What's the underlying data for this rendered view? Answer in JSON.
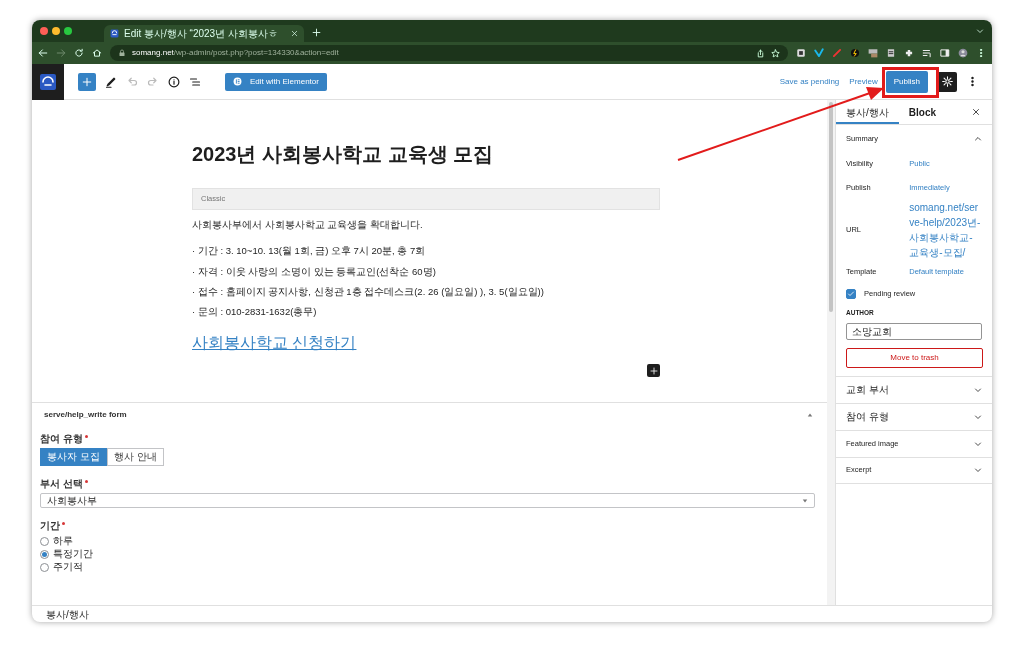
{
  "browser": {
    "tab_title": "Edit 봉사/행사 “2023년 사회봉사ㅎ",
    "url_domain": "somang.net",
    "url_path": "/wp-admin/post.php?post=134330&action=edit"
  },
  "toolbar": {
    "elementor_button": "Edit with Elementor",
    "save_pending": "Save as pending",
    "preview": "Preview",
    "publish": "Publish"
  },
  "post": {
    "title": "2023년 사회봉사학교 교육생 모집",
    "block_label": "Classic",
    "intro": "사회봉사부에서 사회봉사학교 교육생을 확대합니다.",
    "details": [
      "· 기간 : 3. 10~10. 13(월 1회, 금) 오후 7시 20분, 총 7회",
      "· 자격 : 이웃 사랑의 소명이 있는 등록교인(선착순 60명)",
      "· 접수 : 홈페이지 공지사항, 신청관 1층 접수데스크(2. 26 (일요일) ), 3. 5(일요일))",
      "· 문의 : 010-2831-1632(총무)"
    ],
    "link": "사회봉사학교 신청하기"
  },
  "metabox": {
    "title": "serve/help_write form",
    "expanded": true,
    "participation": {
      "label": "참여 유형",
      "required": true,
      "options": [
        {
          "label": "봉사자 모집",
          "selected": true
        },
        {
          "label": "행사 안내",
          "selected": false
        }
      ]
    },
    "department": {
      "label": "부서 선택",
      "required": true,
      "value": "사회봉사부"
    },
    "period": {
      "label": "기간",
      "required": true,
      "options": [
        {
          "label": "하루",
          "selected": false
        },
        {
          "label": "특정기간",
          "selected": true
        },
        {
          "label": "주기적",
          "selected": false
        }
      ]
    }
  },
  "sidebar": {
    "tabs": [
      {
        "label": "봉사/행사",
        "selected": true
      },
      {
        "label": "Block",
        "selected": false
      }
    ],
    "summary": {
      "title": "Summary",
      "expanded": true,
      "rows": [
        {
          "label": "Visibility",
          "value": "Public"
        },
        {
          "label": "Publish",
          "value": "Immediately"
        },
        {
          "label": "URL",
          "value": "somang.net/serve-help/2023년-사회봉사학교-교육생-모집/"
        },
        {
          "label": "Template",
          "value": "Default template"
        }
      ],
      "pending_review": {
        "label": "Pending review",
        "checked": true
      },
      "author": {
        "label": "AUTHOR",
        "value": "소망교회"
      },
      "trash": "Move to trash"
    },
    "panels": [
      {
        "title": "교회 부서",
        "expanded": false
      },
      {
        "title": "참여 유형",
        "expanded": false
      },
      {
        "title": "Featured image",
        "expanded": false
      },
      {
        "title": "Excerpt",
        "expanded": false
      }
    ]
  },
  "footer": {
    "breadcrumb": "봉사/행사"
  },
  "annotation": {
    "highlight_box": true,
    "arrow": true
  }
}
